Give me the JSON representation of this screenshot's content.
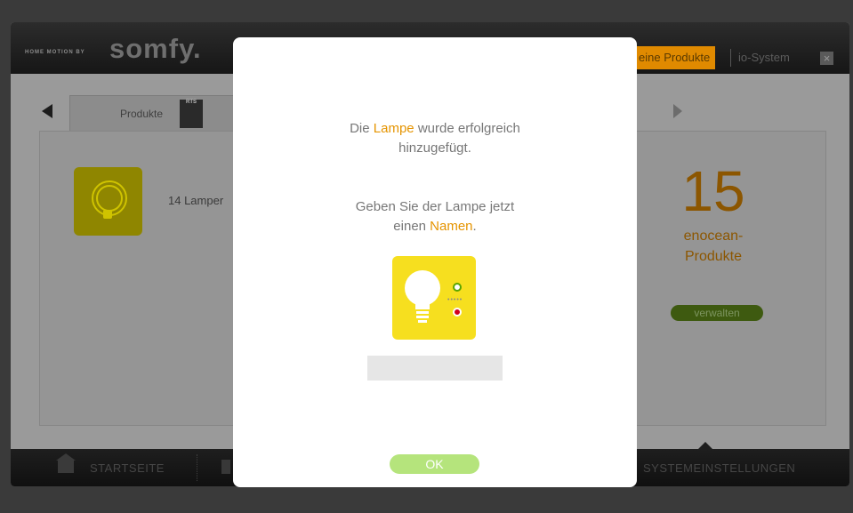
{
  "header": {
    "brand_tagline": "HOME MOTION BY",
    "brand_logo": "somfy.",
    "nav_active": "eine Produkte",
    "nav_item": "io-System",
    "close_symbol": "×"
  },
  "tabs": {
    "products_label": "Produkte",
    "rts_label": "RTS"
  },
  "content": {
    "lamp_count": "14 Lamper",
    "summary_number": "15",
    "summary_label_line1": "enocean-",
    "summary_label_line2": "Produkte",
    "manage_button": "verwalten"
  },
  "bottombar": {
    "home_label": "STARTSEITE",
    "settings_label": "SYSTEMEINSTELLUNGEN"
  },
  "modal": {
    "line1_pre": "Die ",
    "line1_highlight": "Lampe",
    "line1_post": " wurde erfolgreich",
    "line2": "hinzugefügt.",
    "line3": "Geben Sie der Lampe jetzt",
    "line4_pre": "einen ",
    "line4_highlight": "Namen",
    "line4_post": ".",
    "name_input_value": "",
    "ok_button": "OK"
  },
  "colors": {
    "accent": "#e59400",
    "ok_button": "#b5e47c",
    "lamp_yellow": "#f6df1f",
    "led_green": "#5aa500",
    "led_red": "#d1001c"
  }
}
